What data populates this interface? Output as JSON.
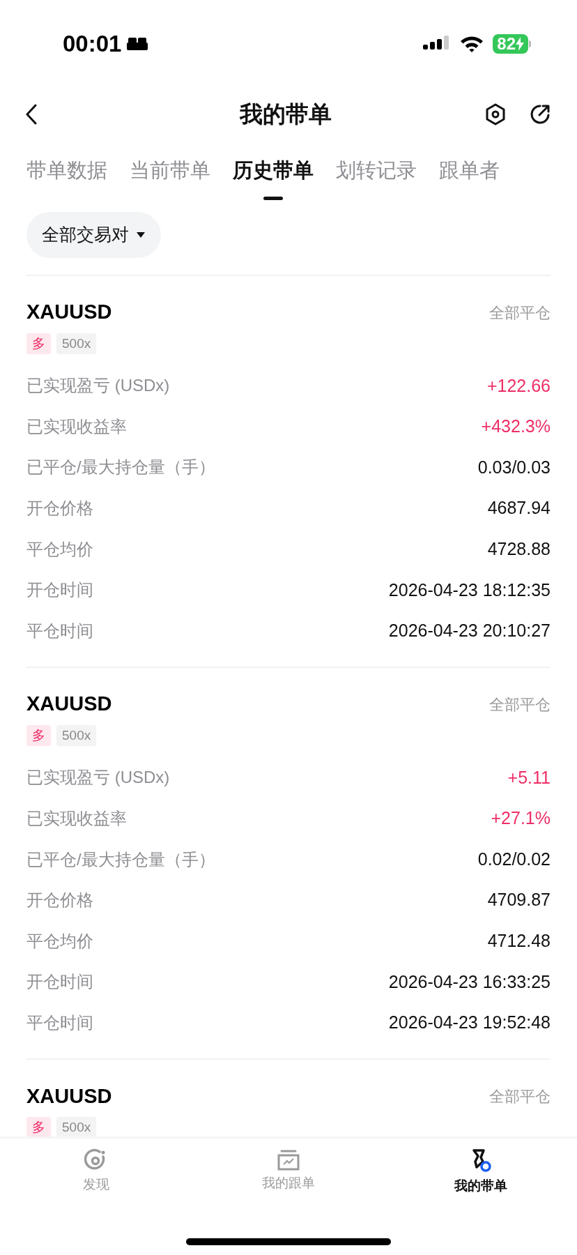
{
  "status_bar": {
    "time": "00:01",
    "battery": "82"
  },
  "header": {
    "title": "我的带单"
  },
  "tabs": [
    {
      "label": "带单数据",
      "selected": false
    },
    {
      "label": "当前带单",
      "selected": false
    },
    {
      "label": "历史带单",
      "selected": true
    },
    {
      "label": "划转记录",
      "selected": false
    },
    {
      "label": "跟单者",
      "selected": false
    }
  ],
  "filter": {
    "label": "全部交易对"
  },
  "orders": [
    {
      "symbol": "XAUUSD",
      "status": "全部平仓",
      "side": "多",
      "leverage": "500x",
      "rows": [
        {
          "label": "已实现盈亏 (USDx)",
          "value": "+122.66",
          "color": "#ee2e66"
        },
        {
          "label": "已实现收益率",
          "value": "+432.3%",
          "color": "#ee2e66"
        },
        {
          "label": "已平仓/最大持仓量（手）",
          "value": "0.03/0.03",
          "color": "#111111"
        },
        {
          "label": "开仓价格",
          "value": "4687.94",
          "color": "#111111"
        },
        {
          "label": "平仓均价",
          "value": "4728.88",
          "color": "#111111"
        },
        {
          "label": "开仓时间",
          "value": "2026-04-23 18:12:35",
          "color": "#111111"
        },
        {
          "label": "平仓时间",
          "value": "2026-04-23 20:10:27",
          "color": "#111111"
        }
      ]
    },
    {
      "symbol": "XAUUSD",
      "status": "全部平仓",
      "side": "多",
      "leverage": "500x",
      "rows": [
        {
          "label": "已实现盈亏 (USDx)",
          "value": "+5.11",
          "color": "#ee2e66"
        },
        {
          "label": "已实现收益率",
          "value": "+27.1%",
          "color": "#ee2e66"
        },
        {
          "label": "已平仓/最大持仓量（手）",
          "value": "0.02/0.02",
          "color": "#111111"
        },
        {
          "label": "开仓价格",
          "value": "4709.87",
          "color": "#111111"
        },
        {
          "label": "平仓均价",
          "value": "4712.48",
          "color": "#111111"
        },
        {
          "label": "开仓时间",
          "value": "2026-04-23 16:33:25",
          "color": "#111111"
        },
        {
          "label": "平仓时间",
          "value": "2026-04-23 19:52:48",
          "color": "#111111"
        }
      ]
    },
    {
      "symbol": "XAUUSD",
      "status": "全部平仓",
      "side": "多",
      "leverage": "500x"
    }
  ],
  "bottom_nav": [
    {
      "label": "发现",
      "kind": "discover",
      "selected": false
    },
    {
      "label": "我的跟单",
      "kind": "follow",
      "selected": false
    },
    {
      "label": "我的带单",
      "kind": "lead",
      "selected": true
    }
  ]
}
